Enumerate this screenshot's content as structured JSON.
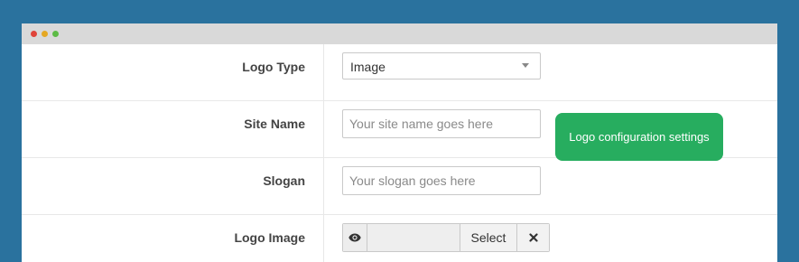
{
  "form": {
    "logo_type": {
      "label": "Logo Type",
      "selected": "Image"
    },
    "site_name": {
      "label": "Site Name",
      "placeholder": "Your site name goes here",
      "value": ""
    },
    "slogan": {
      "label": "Slogan",
      "placeholder": "Your slogan goes here",
      "value": ""
    },
    "logo_image": {
      "label": "Logo Image",
      "select_label": "Select",
      "value": ""
    }
  },
  "tooltip": {
    "text": "Logo configuration settings"
  },
  "colors": {
    "background": "#2a729e",
    "tooltip": "#27ad5f",
    "titlebar": "#d9d9d9",
    "dot_red": "#e0443a",
    "dot_yellow": "#e5a823",
    "dot_green": "#5dbb46"
  },
  "icons": {
    "preview": "eye-icon",
    "clear": "close-icon",
    "dropdown": "chevron-down-icon"
  }
}
